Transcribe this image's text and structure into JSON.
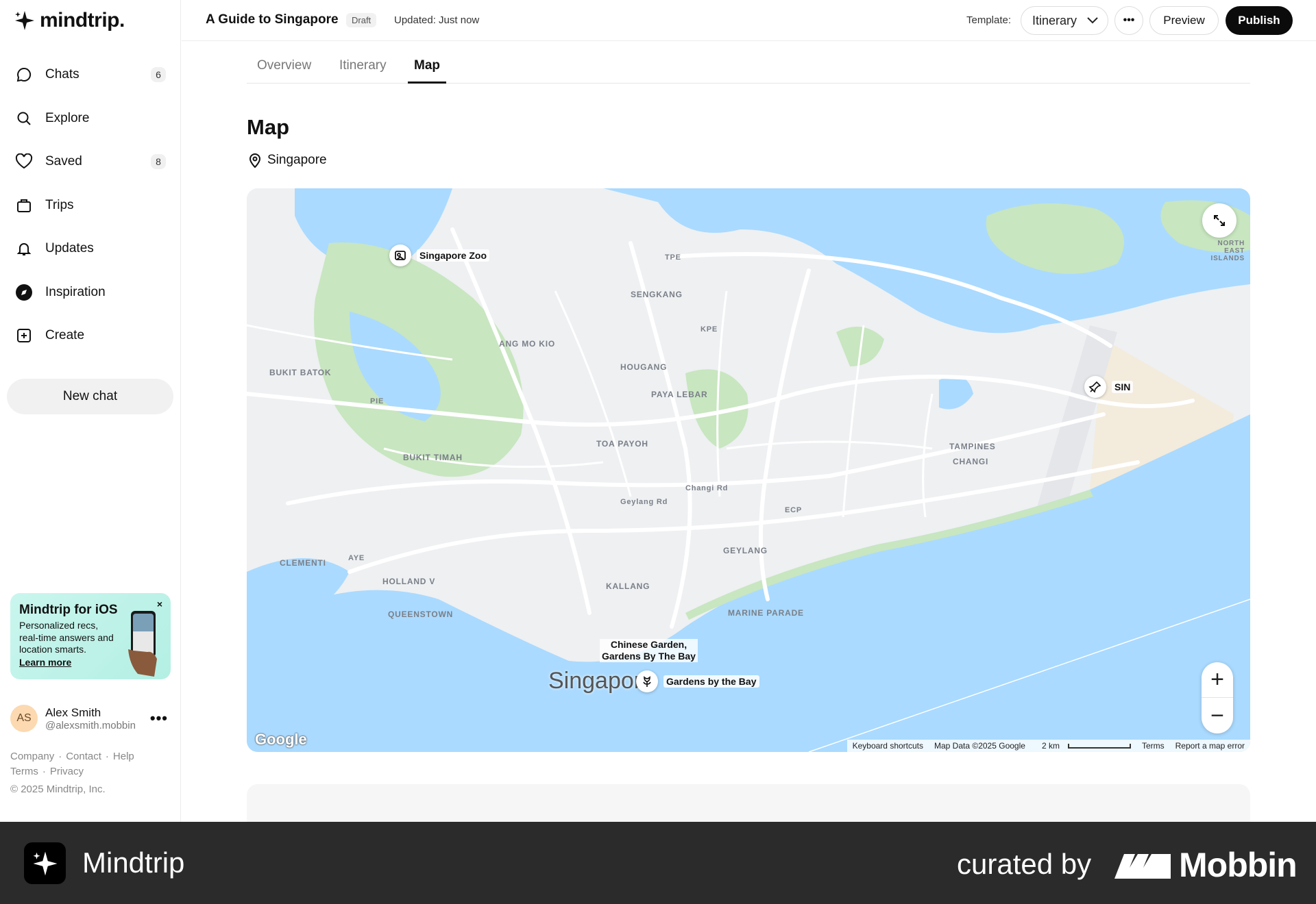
{
  "app": {
    "logo_text": "mindtrip."
  },
  "sidebar": {
    "items": [
      {
        "label": "Chats",
        "icon": "chat-bubble-icon",
        "badge": "6"
      },
      {
        "label": "Explore",
        "icon": "search-icon",
        "badge": ""
      },
      {
        "label": "Saved",
        "icon": "heart-icon",
        "badge": "8"
      },
      {
        "label": "Trips",
        "icon": "suitcase-icon",
        "badge": ""
      },
      {
        "label": "Updates",
        "icon": "bell-icon",
        "badge": ""
      },
      {
        "label": "Inspiration",
        "icon": "compass-icon",
        "badge": ""
      },
      {
        "label": "Create",
        "icon": "plus-square-icon",
        "badge": ""
      }
    ],
    "new_chat": "New chat",
    "promo": {
      "title": "Mindtrip for iOS",
      "text": "Personalized recs, real-time answers and location smarts.",
      "link": "Learn more",
      "close": "×"
    },
    "user": {
      "initials": "AS",
      "name": "Alex Smith",
      "handle": "@alexsmith.mobbin"
    },
    "footer": {
      "company": "Company",
      "contact": "Contact",
      "help": "Help",
      "terms": "Terms",
      "privacy": "Privacy",
      "copyright": "© 2025 Mindtrip, Inc."
    }
  },
  "header": {
    "title": "A Guide to Singapore",
    "status": "Draft",
    "updated": "Updated: Just now",
    "template_label": "Template:",
    "template_value": "Itinerary",
    "more": "•••",
    "preview": "Preview",
    "publish": "Publish"
  },
  "tabs": [
    {
      "label": "Overview",
      "active": false
    },
    {
      "label": "Itinerary",
      "active": false
    },
    {
      "label": "Map",
      "active": true
    }
  ],
  "section": {
    "title": "Map",
    "location": "Singapore"
  },
  "map": {
    "place_labels": [
      "SENGKANG",
      "ANG MO KIO",
      "HOUGANG",
      "PAYA LEBAR",
      "BUKIT BATOK",
      "TOA PAYOH",
      "BUKIT TIMAH",
      "TAMPINES",
      "CHANGI",
      "GEYLANG",
      "CLEMENTI",
      "HOLLAND V",
      "KALLANG",
      "MARINE PARADE",
      "QUEENSTOWN",
      "NORTH EAST ISLANDS",
      "TPE",
      "KPE",
      "PIE",
      "ECP",
      "AYE",
      "Changi Rd",
      "Geylang Rd"
    ],
    "pois": {
      "zoo": "Singapore Zoo",
      "airport": "SIN",
      "gardens": "Gardens by the Bay",
      "cluster": "Chinese Garden,\nGardens By The Bay"
    },
    "city": "Singapore",
    "google": "Google",
    "footer": {
      "shortcuts": "Keyboard shortcuts",
      "data": "Map Data ©2025 Google",
      "scale": "2 km",
      "terms": "Terms",
      "report": "Report a map error"
    },
    "colors": {
      "water": "#aadaff",
      "land": "#f1f3f4",
      "park": "#c8e6c0",
      "road": "#ffffff"
    }
  },
  "brandbar": {
    "app_name": "Mindtrip",
    "curated": "curated by",
    "mobbin": "Mobbin"
  }
}
